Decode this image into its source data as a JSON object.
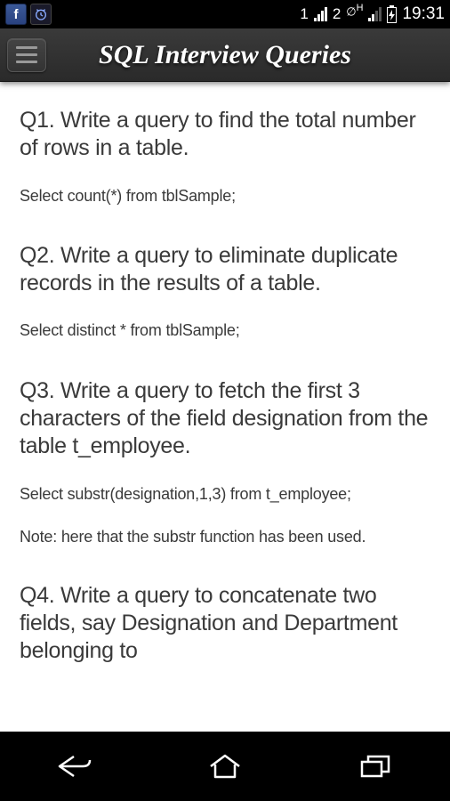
{
  "status": {
    "sim1": "1",
    "sim2": "2",
    "net_indicator": "H",
    "time": "19:31"
  },
  "header": {
    "title": "SQL Interview Queries"
  },
  "content": {
    "items": [
      {
        "q": "Q1. Write a query to find the total number of rows in a table.",
        "a": "Select count(*) from tblSample;"
      },
      {
        "q": "Q2. Write a query to eliminate duplicate records in the results of a table.",
        "a": "Select distinct * from tblSample;"
      },
      {
        "q": "Q3. Write a query to fetch the first 3 characters of the field designation from the table t_employee.",
        "a": "Select substr(designation,1,3) from t_employee;",
        "note": "Note: here that the substr function has been used."
      },
      {
        "q": "Q4. Write a query to concatenate two fields, say Designation and Department belonging to",
        "a": ""
      }
    ]
  }
}
